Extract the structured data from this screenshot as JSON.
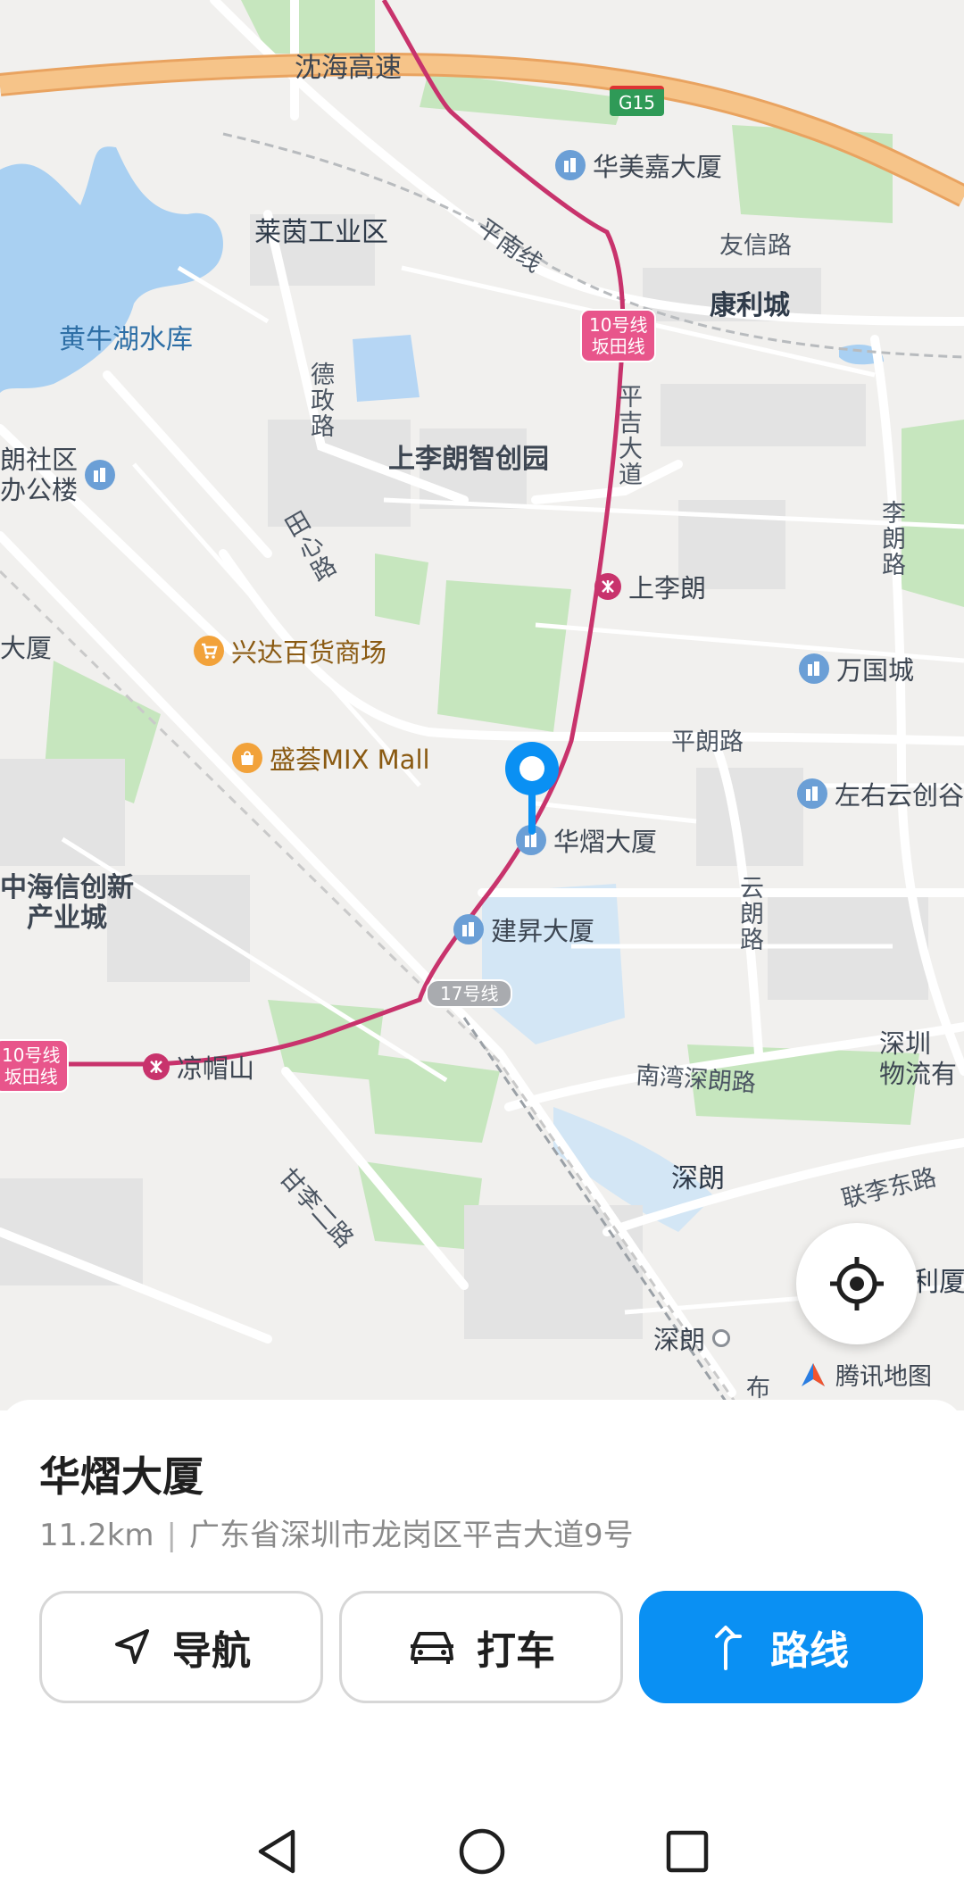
{
  "map": {
    "labels": {
      "highway": "沈海高速",
      "highway_code": "G15",
      "huameijia": "华美嘉大厦",
      "laiyin": "莱茵工业区",
      "pingnan": "平南线",
      "youxin": "友信路",
      "kangli": "康利城",
      "huangniu": "黄牛湖水库",
      "line10": "10号线\n坂田线",
      "deyu": "德政路",
      "pingji": "平吉大道",
      "shangli_park": "上李朗智创园",
      "shequ": "朗社区\n办公楼",
      "lilang": "李朗路",
      "tiangong": "田心路",
      "shanglilang": "上李朗",
      "xingda": "兴达百货商场",
      "dasha_left": "大厦",
      "wanguo": "万国城",
      "pinglang": "平朗路",
      "mixmall": "盛荟MIX Mall",
      "zuoyou": "左右云创谷",
      "huayi": "华熠大厦",
      "zhonghai": "中海信创新\n产业城",
      "jiansheng": "建昇大厦",
      "yunlang": "云朗路",
      "line17": "17号线",
      "line10_left": "10号线\n坂田线",
      "liangmao": "凉帽山",
      "nanwan": "南湾深朗路",
      "shenzhen_wl": "深圳\n物流有",
      "ganli": "甘李二路",
      "shenlang": "深朗",
      "lianli": "联李东路",
      "lidasha": "利厦",
      "shenlang_st": "深朗",
      "bu": "布"
    },
    "watermark": "腾讯地图",
    "pin_icon": "location-pin-icon",
    "locate_icon": "crosshair-icon"
  },
  "place": {
    "name": "华熠大厦",
    "distance": "11.2km",
    "separator": "|",
    "address": "广东省深圳市龙岗区平吉大道9号"
  },
  "actions": {
    "navigate": "导航",
    "taxi": "打车",
    "route": "路线"
  },
  "colors": {
    "primary": "#0a90f3",
    "metro": "#c8336c",
    "highway": "#f2b36d",
    "water": "#a9d0f2",
    "green": "#c6e6be"
  }
}
